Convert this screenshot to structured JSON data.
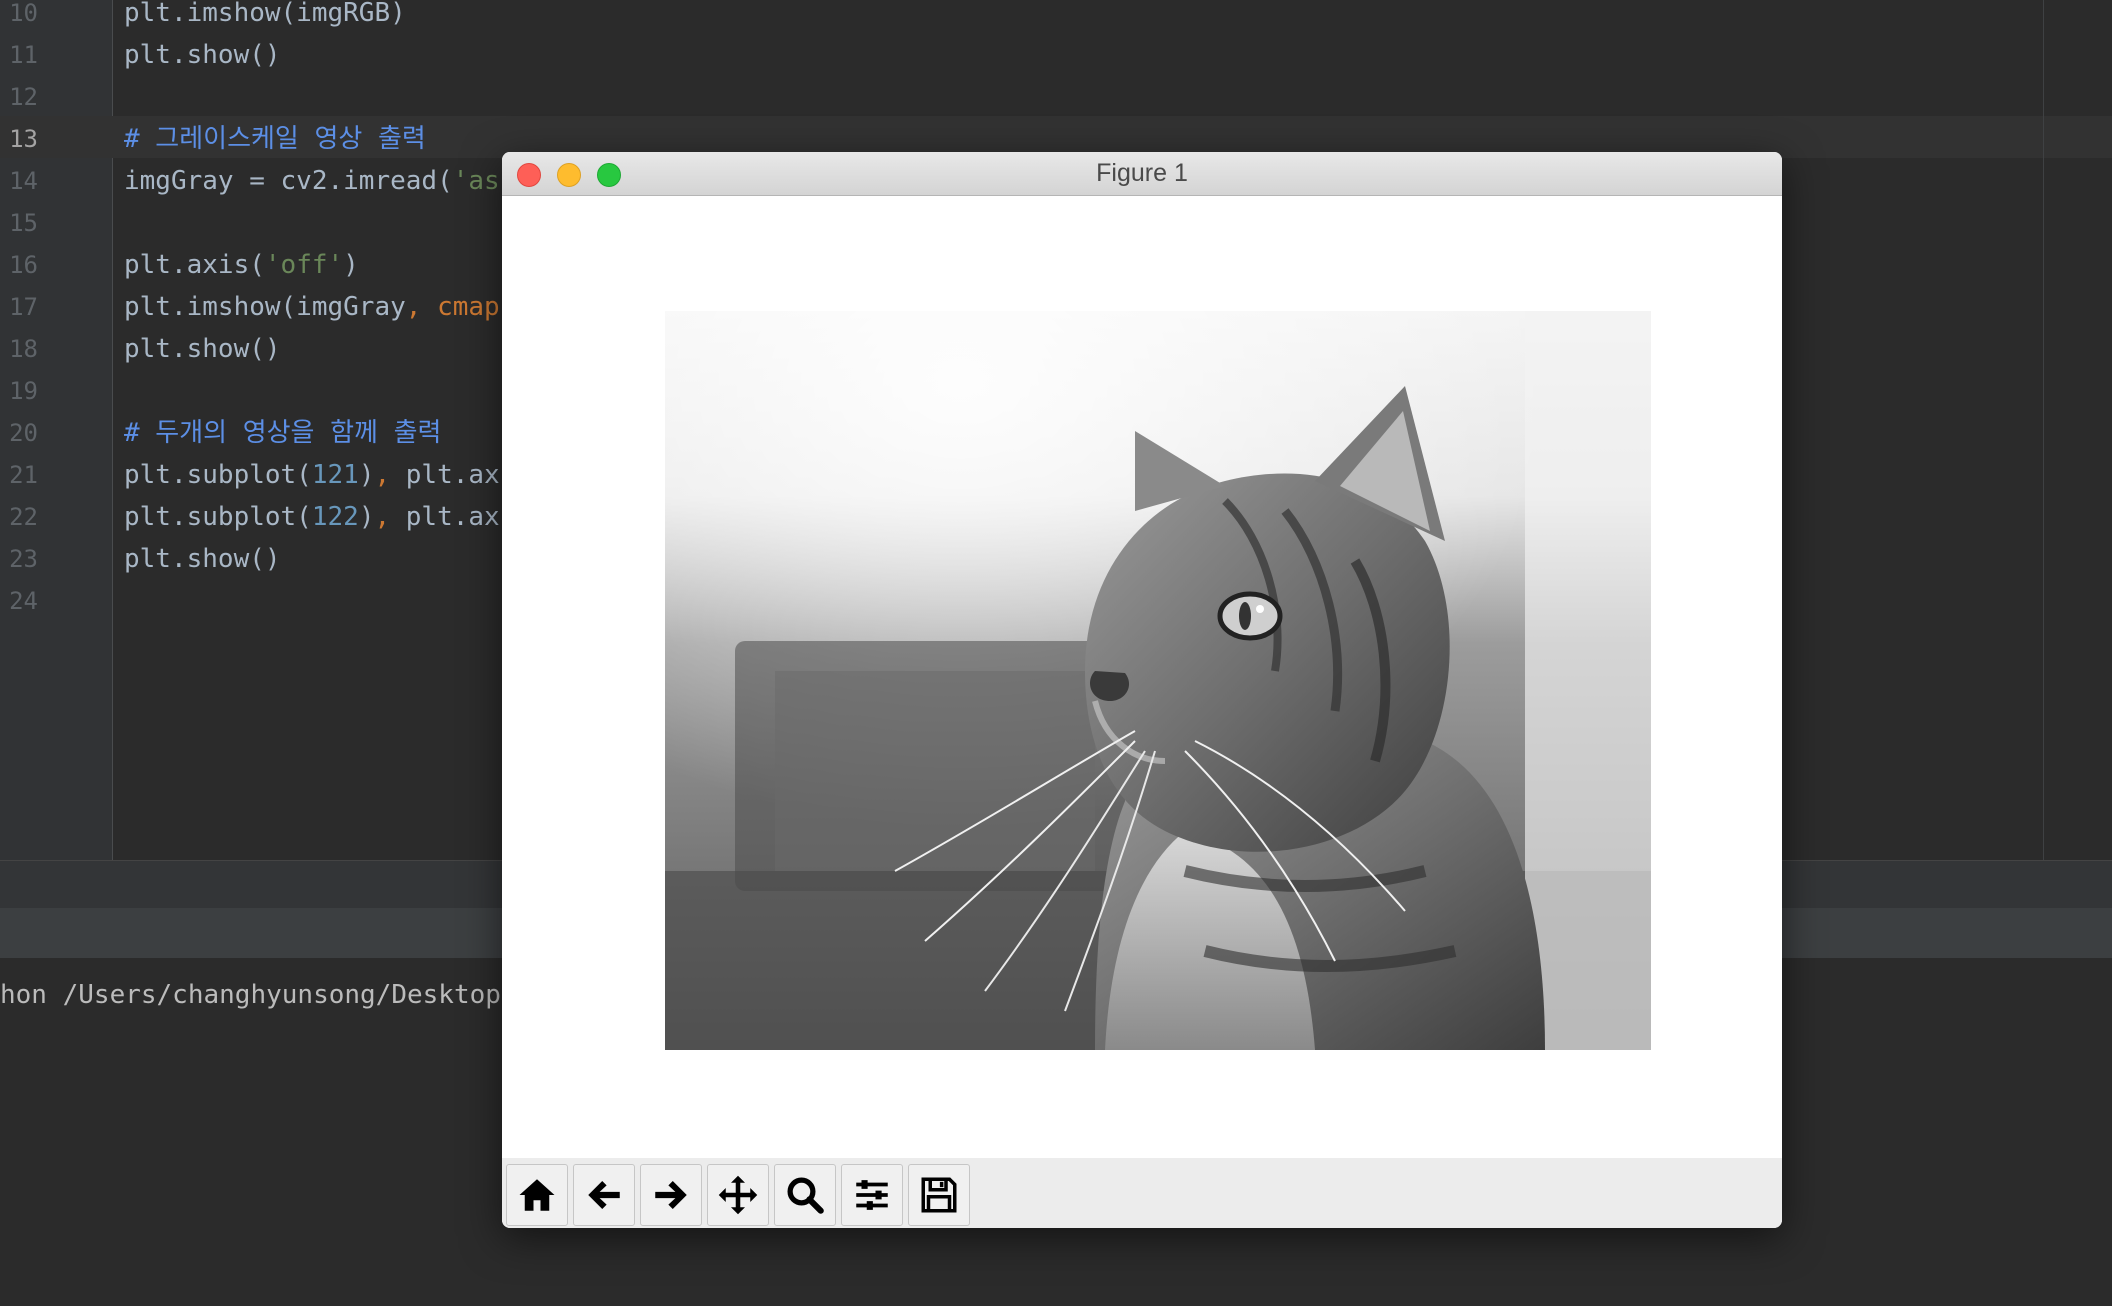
{
  "editor": {
    "lines": [
      {
        "num": "10",
        "code": [
          {
            "t": "plt.imshow(imgRGB)",
            "c": ""
          }
        ]
      },
      {
        "num": "11",
        "code": [
          {
            "t": "plt.show()",
            "c": ""
          }
        ]
      },
      {
        "num": "12",
        "code": []
      },
      {
        "num": "13",
        "code": [
          {
            "t": "# 그레이스케일 영상 출력",
            "c": "c-comment"
          }
        ]
      },
      {
        "num": "14",
        "code": [
          {
            "t": "imgGray = cv2.imread(",
            "c": ""
          },
          {
            "t": "'as",
            "c": "c-string"
          }
        ]
      },
      {
        "num": "15",
        "code": []
      },
      {
        "num": "16",
        "code": [
          {
            "t": "plt.axis(",
            "c": ""
          },
          {
            "t": "'off'",
            "c": "c-string"
          },
          {
            "t": ")",
            "c": ""
          }
        ]
      },
      {
        "num": "17",
        "code": [
          {
            "t": "plt.imshow(imgGray",
            "c": ""
          },
          {
            "t": ", cmap",
            "c": "c-kw"
          }
        ]
      },
      {
        "num": "18",
        "code": [
          {
            "t": "plt.show()",
            "c": ""
          }
        ]
      },
      {
        "num": "19",
        "code": []
      },
      {
        "num": "20",
        "code": [
          {
            "t": "# 두개의 영상을 함께 출력",
            "c": "c-comment"
          }
        ]
      },
      {
        "num": "21",
        "code": [
          {
            "t": "plt.subplot(",
            "c": ""
          },
          {
            "t": "121",
            "c": "c-num"
          },
          {
            "t": ")",
            "c": ""
          },
          {
            "t": ", ",
            "c": "c-kw"
          },
          {
            "t": "plt.ax",
            "c": ""
          }
        ]
      },
      {
        "num": "22",
        "code": [
          {
            "t": "plt.subplot(",
            "c": ""
          },
          {
            "t": "122",
            "c": "c-num"
          },
          {
            "t": ")",
            "c": ""
          },
          {
            "t": ", ",
            "c": "c-kw"
          },
          {
            "t": "plt.ax",
            "c": ""
          }
        ]
      },
      {
        "num": "23",
        "code": [
          {
            "t": "plt.show()",
            "c": ""
          }
        ]
      },
      {
        "num": "24",
        "code": []
      }
    ],
    "current_line": "13"
  },
  "console": {
    "command": "hon /Users/changhyunsong/Desktop"
  },
  "figure_window": {
    "title": "Figure 1",
    "image_subject": "grayscale photo of a tabby cat",
    "toolbar": [
      {
        "name": "home-button",
        "icon": "home-icon"
      },
      {
        "name": "back-button",
        "icon": "arrow-left-icon"
      },
      {
        "name": "forward-button",
        "icon": "arrow-right-icon"
      },
      {
        "name": "pan-button",
        "icon": "move-icon"
      },
      {
        "name": "zoom-button",
        "icon": "magnifier-icon"
      },
      {
        "name": "configure-subplots-button",
        "icon": "sliders-icon"
      },
      {
        "name": "save-button",
        "icon": "floppy-disk-icon"
      }
    ]
  },
  "colors": {
    "editor_bg": "#2b2b2b",
    "comment": "#5c8fe6",
    "string": "#6a8759",
    "number": "#6897bb",
    "keyword": "#cc7832"
  }
}
